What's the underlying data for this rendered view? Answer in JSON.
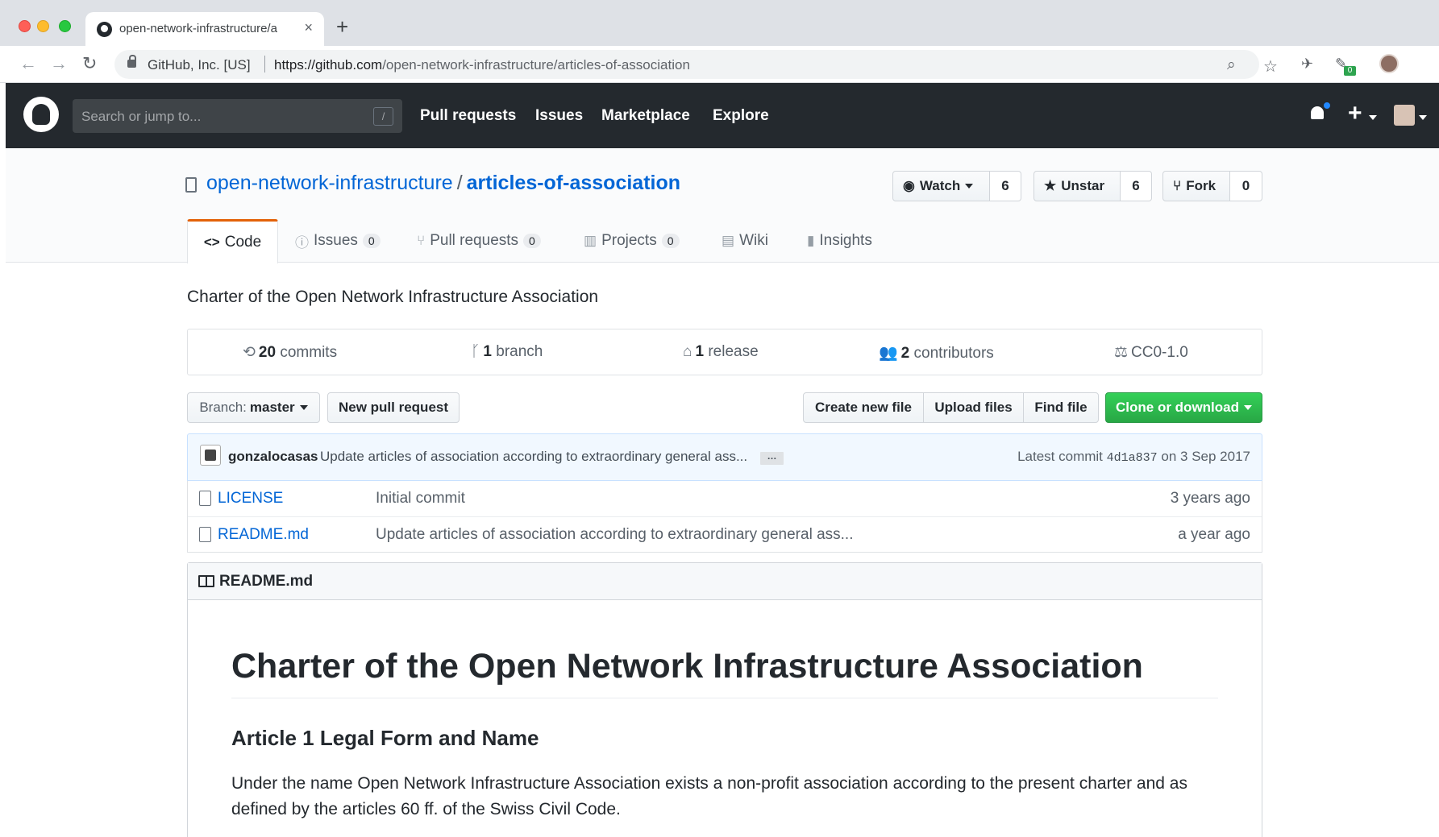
{
  "browser": {
    "tab_title": "open-network-infrastructure/a",
    "tab_close": "×",
    "new_tab": "+",
    "back": "←",
    "forward": "→",
    "reload": "↻",
    "site_identity": "GitHub, Inc. [US]",
    "url_host": "https://github.com",
    "url_path": "/open-network-infrastructure/articles-of-association",
    "zoom_icon": "⌕",
    "bookmark_icon": "☆",
    "extension_badge": "0",
    "menu_icon": "⋮"
  },
  "github_header": {
    "search_placeholder": "Search or jump to...",
    "search_shortcut": "/",
    "nav": [
      "Pull requests",
      "Issues",
      "Marketplace",
      "Explore"
    ],
    "new_icon": "+"
  },
  "repo": {
    "owner": "open-network-infrastructure",
    "separator": "/",
    "name": "articles-of-association",
    "watch_label": "Watch",
    "watch_count": "6",
    "star_label": "Unstar",
    "star_count": "6",
    "fork_label": "Fork",
    "fork_count": "0",
    "tabs": [
      {
        "label": "Code",
        "icon": "<>"
      },
      {
        "label": "Issues",
        "count": "0",
        "icon": "ⓘ"
      },
      {
        "label": "Pull requests",
        "count": "0",
        "icon": "⑂"
      },
      {
        "label": "Projects",
        "count": "0",
        "icon": "▥"
      },
      {
        "label": "Wiki",
        "icon": "▤"
      },
      {
        "label": "Insights",
        "icon": "▮"
      }
    ],
    "description": "Charter of the Open Network Infrastructure Association"
  },
  "summary": {
    "commits_count": "20",
    "commits_label": "commits",
    "branch_count": "1",
    "branch_label": "branch",
    "release_count": "1",
    "release_label": "release",
    "contributors_count": "2",
    "contributors_label": "contributors",
    "license": "CC0-1.0"
  },
  "file_nav": {
    "branch_prefix": "Branch:",
    "branch_name": "master",
    "new_pr": "New pull request",
    "create_file": "Create new file",
    "upload_files": "Upload files",
    "find_file": "Find file",
    "clone": "Clone or download"
  },
  "latest_commit": {
    "author": "gonzalocasas",
    "message": "Update articles of association according to extraordinary general ass...",
    "ellipsis": "…",
    "prefix": "Latest commit",
    "sha": "4d1a837",
    "date": "on 3 Sep 2017"
  },
  "files": [
    {
      "name": "LICENSE",
      "message": "Initial commit",
      "age": "3 years ago"
    },
    {
      "name": "README.md",
      "message": "Update articles of association according to extraordinary general ass...",
      "age": "a year ago"
    }
  ],
  "readme": {
    "header": "README.md",
    "h1": "Charter of the Open Network Infrastructure Association",
    "h2": "Article 1 Legal Form and Name",
    "paragraph": "Under the name Open Network Infrastructure Association exists a non-profit association according to the present charter and as defined by the articles 60 ff. of the Swiss Civil Code."
  },
  "colors": {
    "header_bg": "#24292e",
    "link": "#0366d6",
    "selected_tab_accent": "#e36209",
    "clone_button": "#28a745"
  }
}
